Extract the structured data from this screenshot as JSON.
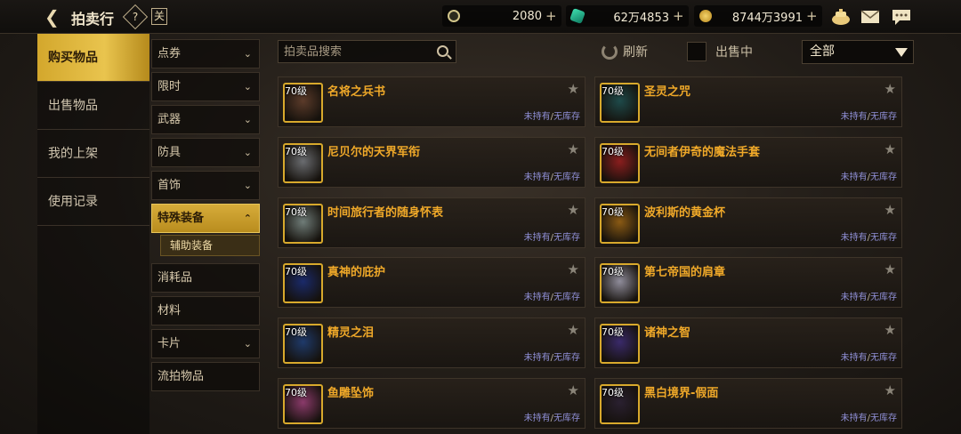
{
  "header": {
    "title": "拍卖行",
    "help_label": "?",
    "calendar_label": "关"
  },
  "currencies": [
    {
      "name": "gold-coin",
      "amount": "2080",
      "plus": "+"
    },
    {
      "name": "cera-gem",
      "amount": "62万4853",
      "plus": "+"
    },
    {
      "name": "gold",
      "amount": "8744万3991",
      "plus": "+"
    }
  ],
  "left_menu": [
    "购买物品",
    "出售物品",
    "我的上架",
    "使用记录"
  ],
  "categories": [
    {
      "label": "点券",
      "chevron": "v"
    },
    {
      "label": "限时",
      "chevron": "v"
    },
    {
      "label": "武器",
      "chevron": "v"
    },
    {
      "label": "防具",
      "chevron": "v"
    },
    {
      "label": "首饰",
      "chevron": "v"
    },
    {
      "label": "特殊装备",
      "chevron": "^"
    },
    {
      "label": "辅助装备"
    },
    {
      "label": "消耗品"
    },
    {
      "label": "材料"
    },
    {
      "label": "卡片",
      "chevron": "v"
    },
    {
      "label": "流拍物品"
    }
  ],
  "search": {
    "placeholder": "拍卖品搜索"
  },
  "refresh_label": "刷新",
  "onsale_label": "出售中",
  "filter": {
    "selected": "全部"
  },
  "items": [
    {
      "level": "70级",
      "name": "名将之兵书",
      "own": "未持有",
      "sep": "/",
      "stock": "无库存",
      "color": "#5b3b2a",
      "icon": "book-icon"
    },
    {
      "level": "70级",
      "name": "圣灵之咒",
      "own": "未持有",
      "sep": "/",
      "stock": "无库存",
      "color": "#1e4a4a",
      "icon": "helmet-icon"
    },
    {
      "level": "70级",
      "name": "尼贝尔的天界军衔",
      "own": "未持有",
      "sep": "/",
      "stock": "无库存",
      "color": "#6a6c70",
      "icon": "star-badge-icon"
    },
    {
      "level": "70级",
      "name": "无间者伊奇的魔法手套",
      "own": "未持有",
      "sep": "/",
      "stock": "无库存",
      "color": "#8a1e1e",
      "icon": "glove-icon"
    },
    {
      "level": "70级",
      "name": "时间旅行者的随身怀表",
      "own": "未持有",
      "sep": "/",
      "stock": "无库存",
      "color": "#6f7c78",
      "icon": "pocket-watch-icon"
    },
    {
      "level": "70级",
      "name": "波利斯的黄金杯",
      "own": "未持有",
      "sep": "/",
      "stock": "无库存",
      "color": "#8a5a14",
      "icon": "golden-cup-icon"
    },
    {
      "level": "70级",
      "name": "真神的庇护",
      "own": "未持有",
      "sep": "/",
      "stock": "无库存",
      "color": "#1a2a6a",
      "icon": "red-gem-icon"
    },
    {
      "level": "70级",
      "name": "第七帝国的肩章",
      "own": "未持有",
      "sep": "/",
      "stock": "无库存",
      "color": "#8f8c9a",
      "icon": "epaulet-icon"
    },
    {
      "level": "70级",
      "name": "精灵之泪",
      "own": "未持有",
      "sep": "/",
      "stock": "无库存",
      "color": "#1f3a6a",
      "icon": "teardrop-icon"
    },
    {
      "level": "70级",
      "name": "诸神之智",
      "own": "未持有",
      "sep": "/",
      "stock": "无库存",
      "color": "#3a2a6a",
      "icon": "feather-icon"
    },
    {
      "level": "70级",
      "name": "鱼雕坠饰",
      "own": "未持有",
      "sep": "/",
      "stock": "无库存",
      "color": "#8a3a6a",
      "icon": "fish-pendant-icon"
    },
    {
      "level": "70级",
      "name": "黑白境界-假面",
      "own": "未持有",
      "sep": "/",
      "stock": "无库存",
      "color": "#2a2030",
      "icon": "mask-icon"
    }
  ]
}
